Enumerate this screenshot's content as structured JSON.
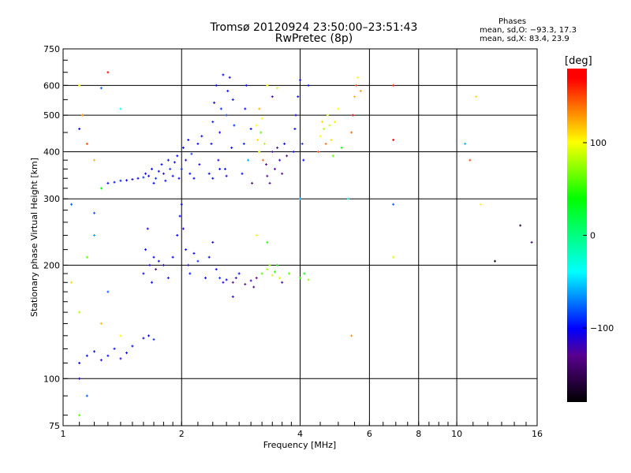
{
  "chart_data": {
    "type": "scatter",
    "title": "Tromsø 20120924 23:50:00–23:51:43",
    "subtitle": "RwPretec (8p)",
    "xlabel": "Frequency [MHz]",
    "ylabel": "Stationary phase Virtual Height [km]",
    "xscale": "log",
    "yscale": "log",
    "xlim": [
      1,
      16
    ],
    "ylim": [
      75,
      750
    ],
    "xticks": [
      {
        "v": 1,
        "label": "1"
      },
      {
        "v": 2,
        "label": "2"
      },
      {
        "v": 4,
        "label": "4"
      },
      {
        "v": 6,
        "label": "6"
      },
      {
        "v": 8,
        "label": "8"
      },
      {
        "v": 10,
        "label": "10"
      },
      {
        "v": 16,
        "label": "16"
      }
    ],
    "yticks": [
      {
        "v": 75,
        "label": "75"
      },
      {
        "v": 100,
        "label": "100"
      },
      {
        "v": 200,
        "label": "200"
      },
      {
        "v": 300,
        "label": "300"
      },
      {
        "v": 400,
        "label": "400"
      },
      {
        "v": 500,
        "label": "500"
      },
      {
        "v": 600,
        "label": "600"
      },
      {
        "v": 750,
        "label": "750"
      }
    ],
    "grid_x": [
      2,
      4,
      6,
      8,
      10
    ],
    "grid_y": [
      100,
      200,
      300,
      400,
      500,
      600
    ],
    "stats": {
      "heading": "Phases",
      "o_mode": "mean, sd,O: −93.3, 17.3",
      "x_mode": "mean, sd,X: 83.4, 23.9"
    },
    "colorbar": {
      "unit": "[deg]",
      "range": [
        -180,
        180
      ],
      "ticks": [
        {
          "v": 100,
          "label": "100"
        },
        {
          "v": 0,
          "label": "0"
        },
        {
          "v": -100,
          "label": "−100"
        }
      ]
    },
    "points_format": [
      "frequency_MHz",
      "height_km",
      "phase_deg"
    ],
    "points": [
      [
        1.3,
        330,
        -100
      ],
      [
        1.35,
        332,
        -100
      ],
      [
        1.4,
        335,
        -95
      ],
      [
        1.45,
        336,
        -100
      ],
      [
        1.5,
        338,
        -110
      ],
      [
        1.55,
        340,
        -100
      ],
      [
        1.6,
        342,
        -90
      ],
      [
        1.62,
        350,
        -100
      ],
      [
        1.65,
        345,
        -105
      ],
      [
        1.68,
        360,
        -100
      ],
      [
        1.7,
        330,
        -100
      ],
      [
        1.72,
        340,
        -90
      ],
      [
        1.75,
        355,
        -100
      ],
      [
        1.78,
        370,
        -100
      ],
      [
        1.8,
        350,
        -110
      ],
      [
        1.82,
        335,
        -100
      ],
      [
        1.85,
        380,
        -100
      ],
      [
        1.87,
        360,
        -90
      ],
      [
        1.9,
        345,
        -100
      ],
      [
        1.92,
        375,
        -105
      ],
      [
        1.95,
        390,
        -100
      ],
      [
        1.97,
        340,
        -100
      ],
      [
        2.0,
        360,
        -90
      ],
      [
        2.02,
        410,
        -100
      ],
      [
        2.05,
        380,
        -110
      ],
      [
        2.08,
        430,
        -100
      ],
      [
        2.1,
        350,
        -100
      ],
      [
        2.12,
        395,
        -85
      ],
      [
        2.15,
        340,
        -100
      ],
      [
        2.2,
        420,
        -100
      ],
      [
        2.22,
        370,
        -110
      ],
      [
        2.25,
        440,
        -100
      ],
      [
        2.35,
        350,
        -100
      ],
      [
        2.38,
        420,
        -100
      ],
      [
        2.4,
        480,
        -95
      ],
      [
        2.42,
        540,
        -100
      ],
      [
        2.45,
        600,
        -100
      ],
      [
        2.48,
        380,
        -110
      ],
      [
        2.5,
        450,
        -100
      ],
      [
        2.52,
        520,
        -90
      ],
      [
        2.55,
        640,
        -100
      ],
      [
        2.58,
        360,
        -100
      ],
      [
        2.6,
        500,
        -80
      ],
      [
        2.62,
        580,
        -100
      ],
      [
        2.65,
        630,
        -105
      ],
      [
        2.68,
        410,
        -100
      ],
      [
        2.7,
        550,
        -100
      ],
      [
        2.72,
        470,
        -90
      ],
      [
        2.4,
        340,
        -100
      ],
      [
        2.5,
        360,
        -100
      ],
      [
        2.6,
        345,
        -110
      ],
      [
        2.85,
        350,
        -100
      ],
      [
        2.88,
        420,
        -95
      ],
      [
        2.9,
        520,
        -100
      ],
      [
        2.92,
        600,
        -100
      ],
      [
        2.95,
        380,
        -60
      ],
      [
        3.0,
        460,
        -100
      ],
      [
        3.02,
        330,
        -130
      ],
      [
        3.1,
        470,
        100
      ],
      [
        3.12,
        430,
        110
      ],
      [
        3.15,
        400,
        90
      ],
      [
        3.18,
        450,
        60
      ],
      [
        3.2,
        490,
        100
      ],
      [
        3.22,
        380,
        140
      ],
      [
        3.25,
        420,
        80
      ],
      [
        3.15,
        520,
        120
      ],
      [
        3.28,
        370,
        -130
      ],
      [
        3.3,
        345,
        -130
      ],
      [
        3.35,
        330,
        -130
      ],
      [
        3.4,
        400,
        -120
      ],
      [
        3.45,
        360,
        -130
      ],
      [
        3.5,
        410,
        -130
      ],
      [
        3.55,
        380,
        -120
      ],
      [
        3.6,
        350,
        -130
      ],
      [
        3.65,
        420,
        -100
      ],
      [
        3.7,
        390,
        -130
      ],
      [
        3.4,
        560,
        -120
      ],
      [
        3.5,
        590,
        90
      ],
      [
        3.3,
        600,
        100
      ],
      [
        3.85,
        400,
        -100
      ],
      [
        3.88,
        460,
        -100
      ],
      [
        3.9,
        500,
        -110
      ],
      [
        3.95,
        560,
        -100
      ],
      [
        4.0,
        620,
        -100
      ],
      [
        4.05,
        420,
        -90
      ],
      [
        4.08,
        380,
        -100
      ],
      [
        4.0,
        300,
        -60
      ],
      [
        4.45,
        400,
        150
      ],
      [
        4.5,
        440,
        100
      ],
      [
        4.55,
        480,
        110
      ],
      [
        4.6,
        460,
        80
      ],
      [
        4.65,
        420,
        140
      ],
      [
        4.7,
        500,
        100
      ],
      [
        4.75,
        470,
        90
      ],
      [
        4.8,
        430,
        110
      ],
      [
        4.85,
        390,
        60
      ],
      [
        4.9,
        480,
        100
      ],
      [
        5.0,
        520,
        100
      ],
      [
        5.4,
        450,
        140
      ],
      [
        5.45,
        500,
        170
      ],
      [
        5.5,
        560,
        120
      ],
      [
        5.55,
        600,
        150
      ],
      [
        5.6,
        630,
        100
      ],
      [
        5.7,
        580,
        130
      ],
      [
        5.3,
        300,
        -40
      ],
      [
        6.9,
        600,
        160
      ],
      [
        6.9,
        430,
        170
      ],
      [
        6.9,
        290,
        -80
      ],
      [
        5.1,
        410,
        40
      ],
      [
        4.2,
        600,
        -100
      ],
      [
        1.6,
        190,
        -100
      ],
      [
        1.62,
        220,
        -100
      ],
      [
        1.64,
        250,
        -105
      ],
      [
        1.66,
        200,
        -110
      ],
      [
        1.68,
        180,
        -100
      ],
      [
        1.7,
        210,
        -100
      ],
      [
        1.72,
        195,
        -130
      ],
      [
        1.75,
        205,
        -100
      ],
      [
        1.8,
        200,
        -110
      ],
      [
        1.85,
        185,
        -100
      ],
      [
        1.9,
        210,
        -100
      ],
      [
        1.95,
        240,
        -100
      ],
      [
        1.98,
        270,
        -100
      ],
      [
        2.0,
        290,
        -100
      ],
      [
        2.02,
        250,
        -110
      ],
      [
        2.05,
        220,
        -100
      ],
      [
        2.08,
        200,
        -120
      ],
      [
        2.1,
        190,
        -100
      ],
      [
        2.15,
        215,
        -100
      ],
      [
        2.2,
        205,
        -90
      ],
      [
        2.3,
        185,
        -100
      ],
      [
        2.35,
        210,
        -100
      ],
      [
        2.4,
        230,
        -110
      ],
      [
        2.45,
        195,
        -100
      ],
      [
        2.5,
        185,
        -90
      ],
      [
        2.55,
        180,
        -110
      ],
      [
        2.6,
        183,
        -100
      ],
      [
        2.7,
        180,
        -130
      ],
      [
        2.75,
        185,
        -120
      ],
      [
        2.8,
        190,
        -100
      ],
      [
        2.9,
        178,
        -130
      ],
      [
        3.0,
        182,
        -120
      ],
      [
        3.05,
        175,
        -140
      ],
      [
        3.1,
        185,
        -130
      ],
      [
        2.7,
        165,
        -110
      ],
      [
        3.2,
        190,
        60
      ],
      [
        3.3,
        195,
        80
      ],
      [
        3.35,
        200,
        70
      ],
      [
        3.4,
        188,
        90
      ],
      [
        3.45,
        192,
        50
      ],
      [
        3.5,
        200,
        40
      ],
      [
        3.55,
        185,
        90
      ],
      [
        3.6,
        180,
        -120
      ],
      [
        3.75,
        190,
        60
      ],
      [
        4.0,
        185,
        50
      ],
      [
        4.1,
        190,
        40
      ],
      [
        4.2,
        183,
        70
      ],
      [
        3.1,
        240,
        100
      ],
      [
        3.3,
        230,
        50
      ],
      [
        1.15,
        115,
        -100
      ],
      [
        1.2,
        118,
        -100
      ],
      [
        1.25,
        112,
        -110
      ],
      [
        1.3,
        115,
        -100
      ],
      [
        1.35,
        120,
        -100
      ],
      [
        1.4,
        113,
        -110
      ],
      [
        1.45,
        117,
        -100
      ],
      [
        1.5,
        122,
        -100
      ],
      [
        1.6,
        128,
        -100
      ],
      [
        1.65,
        130,
        -100
      ],
      [
        1.7,
        127,
        -90
      ],
      [
        1.1,
        110,
        -100
      ],
      [
        1.1,
        100,
        -110
      ],
      [
        1.15,
        90,
        -80
      ],
      [
        1.1,
        80,
        60
      ],
      [
        1.1,
        600,
        100
      ],
      [
        1.12,
        500,
        130
      ],
      [
        1.1,
        460,
        -100
      ],
      [
        1.15,
        420,
        150
      ],
      [
        1.2,
        380,
        120
      ],
      [
        1.25,
        320,
        40
      ],
      [
        1.05,
        290,
        -80
      ],
      [
        1.2,
        275,
        -80
      ],
      [
        1.15,
        210,
        60
      ],
      [
        1.3,
        650,
        170
      ],
      [
        1.25,
        590,
        -80
      ],
      [
        1.4,
        520,
        -40
      ],
      [
        1.2,
        240,
        -60
      ],
      [
        1.3,
        170,
        -80
      ],
      [
        1.1,
        150,
        80
      ],
      [
        1.25,
        140,
        120
      ],
      [
        1.4,
        130,
        100
      ],
      [
        1.05,
        180,
        110
      ],
      [
        10.5,
        420,
        -60
      ],
      [
        10.8,
        380,
        150
      ],
      [
        11.2,
        560,
        110
      ],
      [
        11.5,
        290,
        100
      ],
      [
        12.5,
        205,
        -170
      ],
      [
        14.5,
        255,
        -160
      ],
      [
        15.5,
        230,
        -140
      ],
      [
        6.9,
        210,
        90
      ],
      [
        5.4,
        130,
        130
      ]
    ]
  }
}
